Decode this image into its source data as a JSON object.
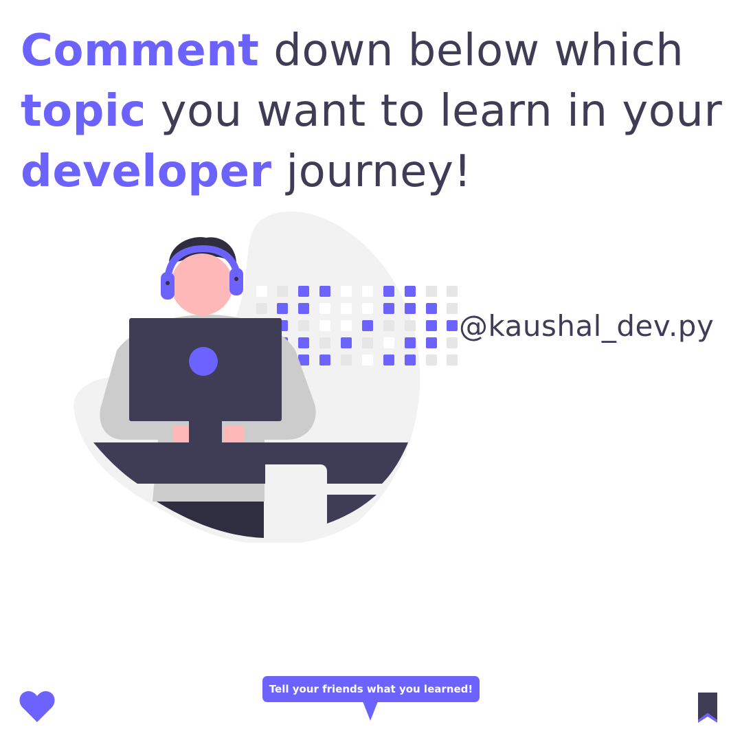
{
  "headline": {
    "line1": {
      "highlight": "Comment",
      "rest": " down below which"
    },
    "line2": {
      "highlight": "topic",
      "rest": " you want to learn in your"
    },
    "line3": {
      "highlight": "developer",
      "rest": " journey!"
    }
  },
  "handle": "@kaushal_dev.py",
  "cta": {
    "label": "Tell your friends what you learned!"
  },
  "icons": {
    "like": "heart-icon",
    "save": "bookmark-icon",
    "illustration": "developer-with-headphones-at-computer"
  },
  "colors": {
    "accent": "#6c63ff",
    "dark": "#3f3d56",
    "skin": "#ffb8b8",
    "light_gray": "#f2f2f2",
    "mid_gray": "#cccccc"
  }
}
